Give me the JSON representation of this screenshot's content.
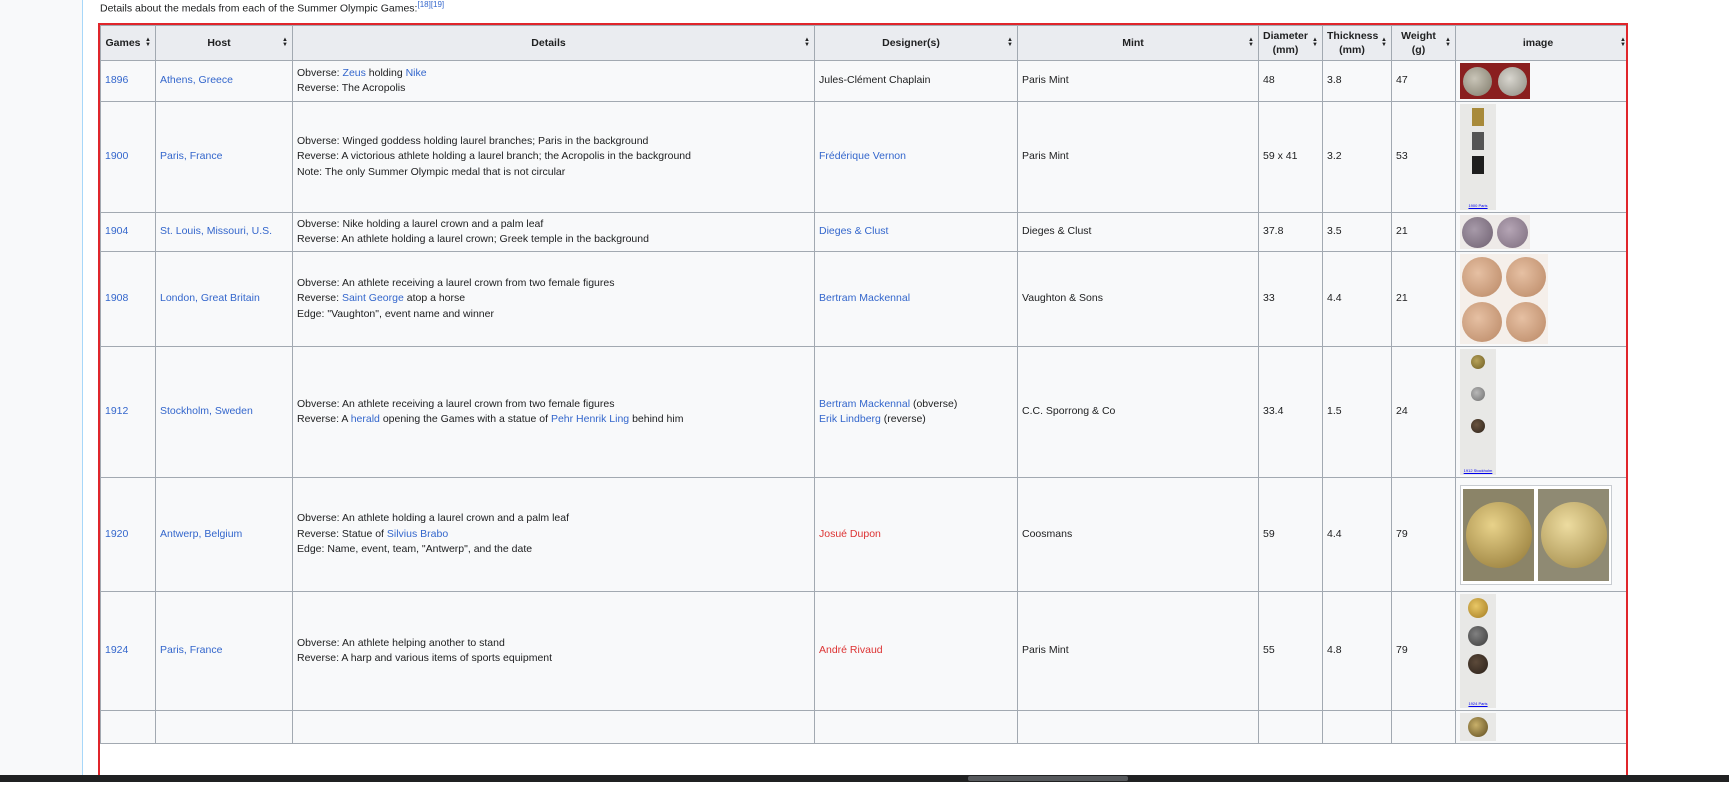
{
  "intro": {
    "text": "Details about the medals from each of the Summer Olympic Games:",
    "refs": "[18][19]"
  },
  "table": {
    "headers": [
      "Games",
      "Host",
      "Details",
      "Designer(s)",
      "Mint",
      "Diameter (mm)",
      "Thickness (mm)",
      "Weight (g)",
      "image"
    ],
    "rows": [
      {
        "games": "1896",
        "host": "Athens, Greece",
        "details": [
          [
            {
              "t": "Obverse: "
            },
            {
              "t": "Zeus",
              "link": true
            },
            {
              "t": " holding "
            },
            {
              "t": "Nike",
              "link": true
            }
          ],
          [
            {
              "t": "Reverse: The Acropolis"
            }
          ]
        ],
        "designer": [
          [
            {
              "t": "Jules-Clément Chaplain"
            }
          ]
        ],
        "mint": "Paris Mint",
        "diameter": "48",
        "thickness": "3.8",
        "weight": "47",
        "image": "medal-1896"
      },
      {
        "games": "1900",
        "host": "Paris, France",
        "details": [
          [
            {
              "t": "Obverse: Winged goddess holding laurel branches; Paris in the background"
            }
          ],
          [
            {
              "t": "Reverse: A victorious athlete holding a laurel branch; the Acropolis in the background"
            }
          ],
          [
            {
              "t": "Note: The only Summer Olympic medal that is not circular"
            }
          ]
        ],
        "designer": [
          [
            {
              "t": "Frédérique Vernon",
              "link": true
            }
          ]
        ],
        "mint": "Paris Mint",
        "diameter": "59 x 41",
        "thickness": "3.2",
        "weight": "53",
        "image": "medal-1900",
        "image_caption": "1900 Paris"
      },
      {
        "games": "1904",
        "host": "St. Louis, Missouri, U.S.",
        "details": [
          [
            {
              "t": "Obverse: Nike holding a laurel crown and a palm leaf"
            }
          ],
          [
            {
              "t": "Reverse: An athlete holding a laurel crown; Greek temple in the background"
            }
          ]
        ],
        "designer": [
          [
            {
              "t": "Dieges & Clust",
              "link": true
            }
          ]
        ],
        "mint": "Dieges & Clust",
        "diameter": "37.8",
        "thickness": "3.5",
        "weight": "21",
        "image": "medal-1904"
      },
      {
        "games": "1908",
        "host": "London, Great Britain",
        "details": [
          [
            {
              "t": "Obverse: An athlete receiving a laurel crown from two female figures"
            }
          ],
          [
            {
              "t": "Reverse: "
            },
            {
              "t": "Saint George",
              "link": true
            },
            {
              "t": " atop a horse"
            }
          ],
          [
            {
              "t": "Edge: \"Vaughton\", event name and winner"
            }
          ]
        ],
        "designer": [
          [
            {
              "t": "Bertram Mackennal",
              "link": true
            }
          ]
        ],
        "mint": "Vaughton & Sons",
        "diameter": "33",
        "thickness": "4.4",
        "weight": "21",
        "image": "medal-1908"
      },
      {
        "games": "1912",
        "host": "Stockholm, Sweden",
        "details": [
          [
            {
              "t": "Obverse: An athlete receiving a laurel crown from two female figures"
            }
          ],
          [
            {
              "t": "Reverse: A "
            },
            {
              "t": "herald",
              "link": true
            },
            {
              "t": " opening the Games with a statue of "
            },
            {
              "t": "Pehr Henrik Ling",
              "link": true
            },
            {
              "t": " behind him"
            }
          ]
        ],
        "designer": [
          [
            {
              "t": "Bertram Mackennal",
              "link": true
            },
            {
              "t": " (obverse)"
            }
          ],
          [
            {
              "t": "Erik Lindberg",
              "link": true
            },
            {
              "t": " (reverse)"
            }
          ]
        ],
        "mint": "C.C. Sporrong & Co",
        "diameter": "33.4",
        "thickness": "1.5",
        "weight": "24",
        "image": "medal-1912",
        "image_caption": "1912 Stockholm"
      },
      {
        "games": "1920",
        "host": "Antwerp, Belgium",
        "details": [
          [
            {
              "t": "Obverse: An athlete holding a laurel crown and a palm leaf"
            }
          ],
          [
            {
              "t": "Reverse: Statue of "
            },
            {
              "t": "Silvius Brabo",
              "link": true
            }
          ],
          [
            {
              "t": "Edge: Name, event, team, \"Antwerp\", and the date"
            }
          ]
        ],
        "designer": [
          [
            {
              "t": "Josué Dupon",
              "red": true
            }
          ]
        ],
        "mint": "Coosmans",
        "diameter": "59",
        "thickness": "4.4",
        "weight": "79",
        "image": "medal-1920"
      },
      {
        "games": "1924",
        "host": "Paris, France",
        "details": [
          [
            {
              "t": "Obverse: An athlete helping another to stand"
            }
          ],
          [
            {
              "t": "Reverse: A harp and various items of sports equipment"
            }
          ]
        ],
        "designer": [
          [
            {
              "t": "André Rivaud",
              "red": true
            }
          ]
        ],
        "mint": "Paris Mint",
        "diameter": "55",
        "thickness": "4.8",
        "weight": "79",
        "image": "medal-1924",
        "image_caption": "1924 Paris"
      },
      {
        "games": "",
        "host": "",
        "details": [],
        "designer": [],
        "mint": "",
        "diameter": "",
        "thickness": "",
        "weight": "",
        "image": "medal-next"
      }
    ]
  },
  "colors": {
    "link": "#3366cc",
    "redlink": "#d33",
    "highlight_border": "#e0252b",
    "header_bg": "#eaecf0",
    "cell_bg": "#f8f9fa"
  }
}
